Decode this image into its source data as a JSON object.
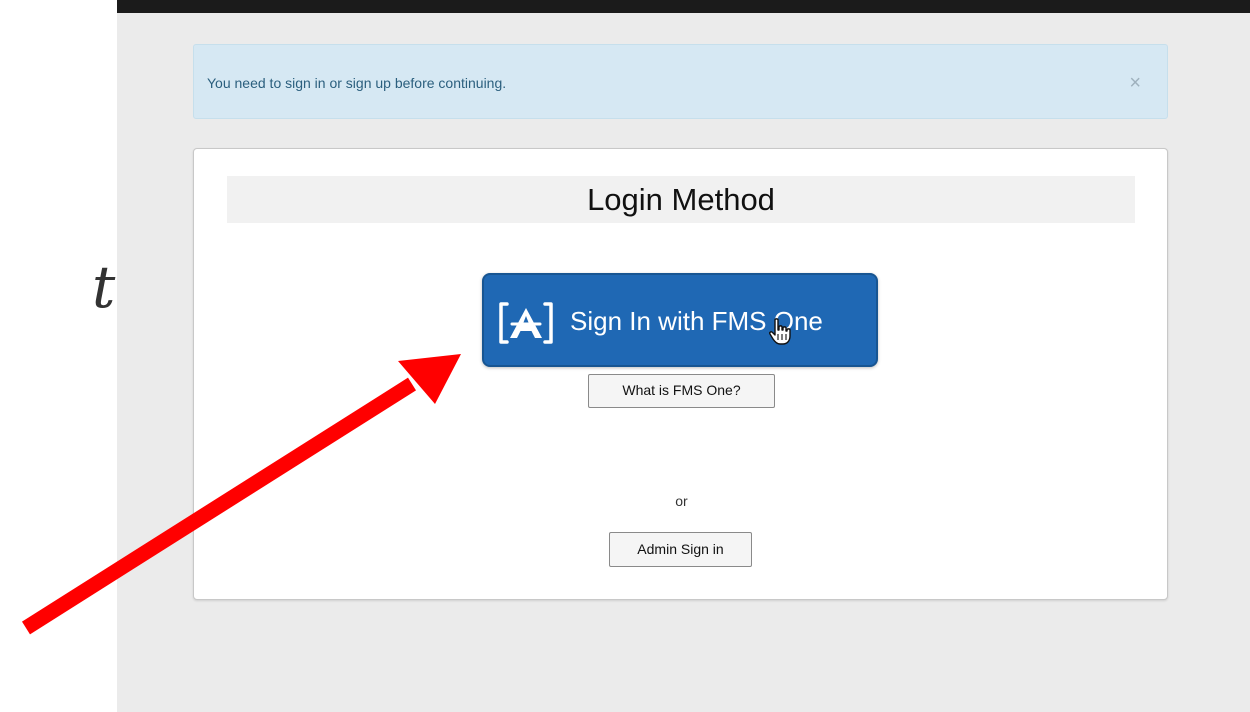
{
  "alert": {
    "message": "You need to sign in or sign up before continuing.",
    "close_glyph": "×"
  },
  "login": {
    "title": "Login Method",
    "fms_button_label": "Sign In with FMS One",
    "fms_logo_icon": "fms-one-bracket-a-logo",
    "what_button_label": "What is FMS One?",
    "separator": "or",
    "admin_button_label": "Admin Sign in"
  },
  "overlay": {
    "stray_glyph": "t",
    "arrow_color": "#ff0000",
    "cursor_icon": "hand-pointer-icon"
  },
  "colors": {
    "alert_bg": "#d6e8f3",
    "primary_button": "#1f68b4",
    "page_bg": "#ebebeb",
    "top_bar": "#1b1b1b"
  }
}
